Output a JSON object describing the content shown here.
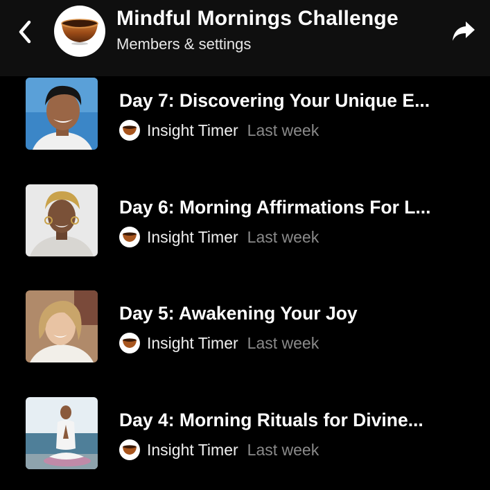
{
  "header": {
    "title": "Mindful Mornings Challenge",
    "subtitle": "Members & settings",
    "back_icon": "chevron-left-icon",
    "share_icon": "share-arrow-icon",
    "avatar_icon": "singing-bowl-icon"
  },
  "items": [
    {
      "title": "Day 7: Discovering Your Unique E...",
      "source": "Insight Timer",
      "when": "Last week"
    },
    {
      "title": "Day 6: Morning Affirmations For L...",
      "source": "Insight Timer",
      "when": "Last week"
    },
    {
      "title": "Day 5: Awakening Your Joy",
      "source": "Insight Timer",
      "when": "Last week"
    },
    {
      "title": "Day 4: Morning Rituals for Divine...",
      "source": "Insight Timer",
      "when": "Last week"
    }
  ],
  "colors": {
    "background": "#000000",
    "header": "#0f0f0f",
    "muted_text": "#8a8a8a",
    "bowl": "#a8561f"
  }
}
